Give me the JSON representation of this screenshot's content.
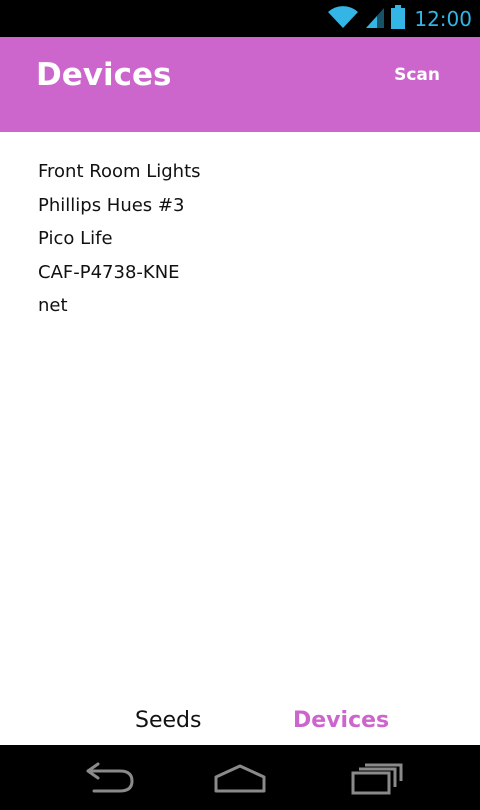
{
  "status_bar": {
    "time": "12:00",
    "icons": [
      "wifi-icon",
      "signal-icon",
      "battery-icon"
    ],
    "accent_color": "#33b5e5"
  },
  "app_bar": {
    "title": "Devices",
    "action_label": "Scan",
    "color": "#cc66cc"
  },
  "devices": [
    {
      "name": "Front Room Lights"
    },
    {
      "name": "Phillips Hues #3"
    },
    {
      "name": "Pico Life"
    },
    {
      "name": "CAF-P4738-KNE"
    },
    {
      "name": "net"
    }
  ],
  "tabs": [
    {
      "label": "Seeds",
      "active": false
    },
    {
      "label": "Devices",
      "active": true
    }
  ],
  "nav_bar": {
    "icons": [
      "back-icon",
      "home-icon",
      "recent-apps-icon"
    ]
  }
}
